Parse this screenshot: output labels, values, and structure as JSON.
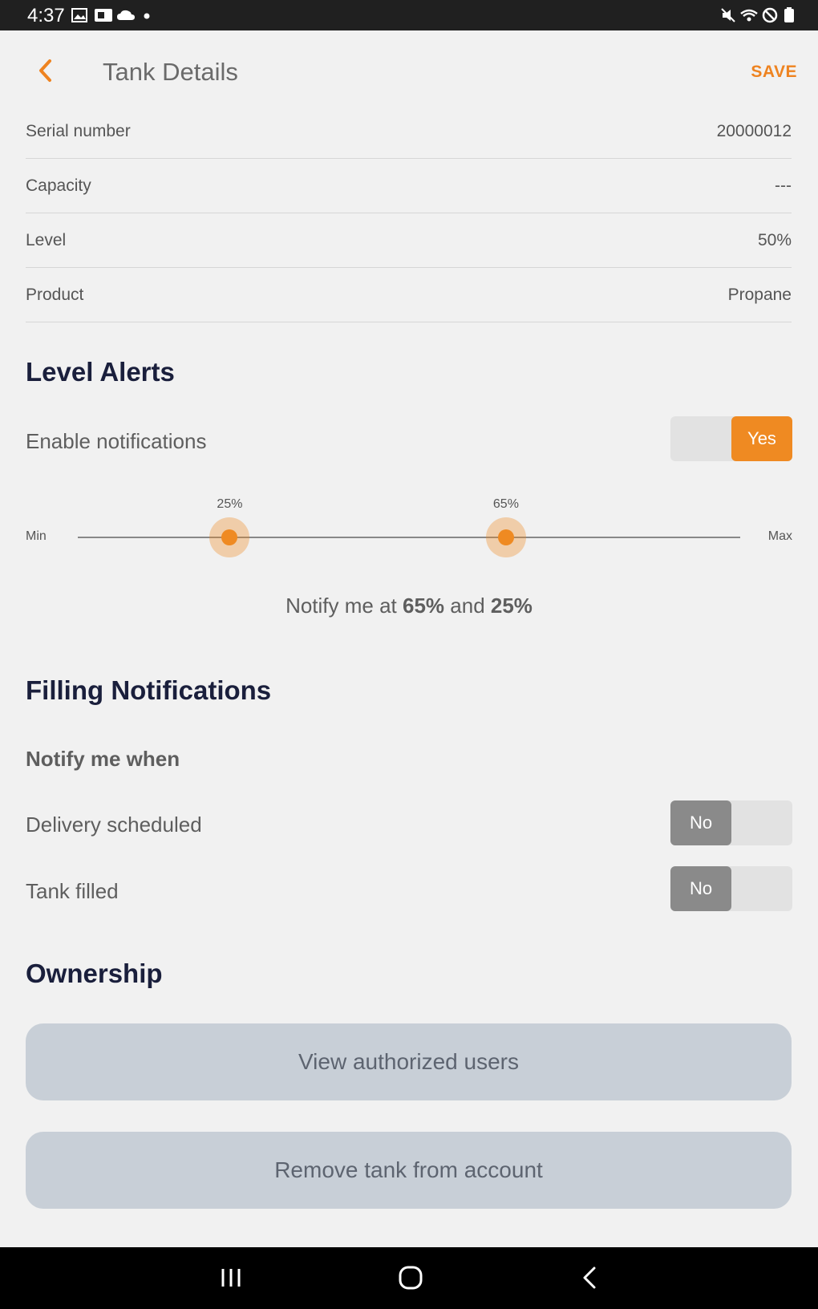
{
  "status_bar": {
    "time": "4:37",
    "left_icons": [
      "image-icon",
      "teams-icon",
      "cloud-icon",
      "dot-icon"
    ],
    "right_icons": [
      "mute-icon",
      "wifi-icon",
      "dnd-icon",
      "battery-icon"
    ]
  },
  "header": {
    "title": "Tank Details",
    "save_label": "SAVE",
    "back_icon": "chevron-left-icon"
  },
  "details": [
    {
      "label": "Serial number",
      "value": "20000012"
    },
    {
      "label": "Capacity",
      "value": "---"
    },
    {
      "label": "Level",
      "value": "50%"
    },
    {
      "label": "Product",
      "value": "Propane"
    }
  ],
  "level_alerts": {
    "heading": "Level Alerts",
    "enable_label": "Enable notifications",
    "enable_toggle": "Yes",
    "slider": {
      "min_label": "Min",
      "max_label": "Max",
      "low_label": "25%",
      "high_label": "65%",
      "low_value": 25,
      "high_value": 65
    },
    "summary_prefix": "Notify me at ",
    "summary_high": "65%",
    "summary_mid": " and ",
    "summary_low": "25%"
  },
  "filling": {
    "heading": "Filling Notifications",
    "subheading": "Notify me when",
    "delivery_label": "Delivery scheduled",
    "delivery_toggle": "No",
    "filled_label": "Tank filled",
    "filled_toggle": "No"
  },
  "ownership": {
    "heading": "Ownership",
    "view_users_label": "View authorized users",
    "remove_tank_label": "Remove tank from account"
  },
  "colors": {
    "accent": "#ef8a22",
    "heading": "#1a1f3c",
    "button_bg": "#c8cfd7",
    "toggle_off": "#8a8a8a"
  },
  "nav_bar": [
    "recents-icon",
    "home-icon",
    "back-icon"
  ]
}
